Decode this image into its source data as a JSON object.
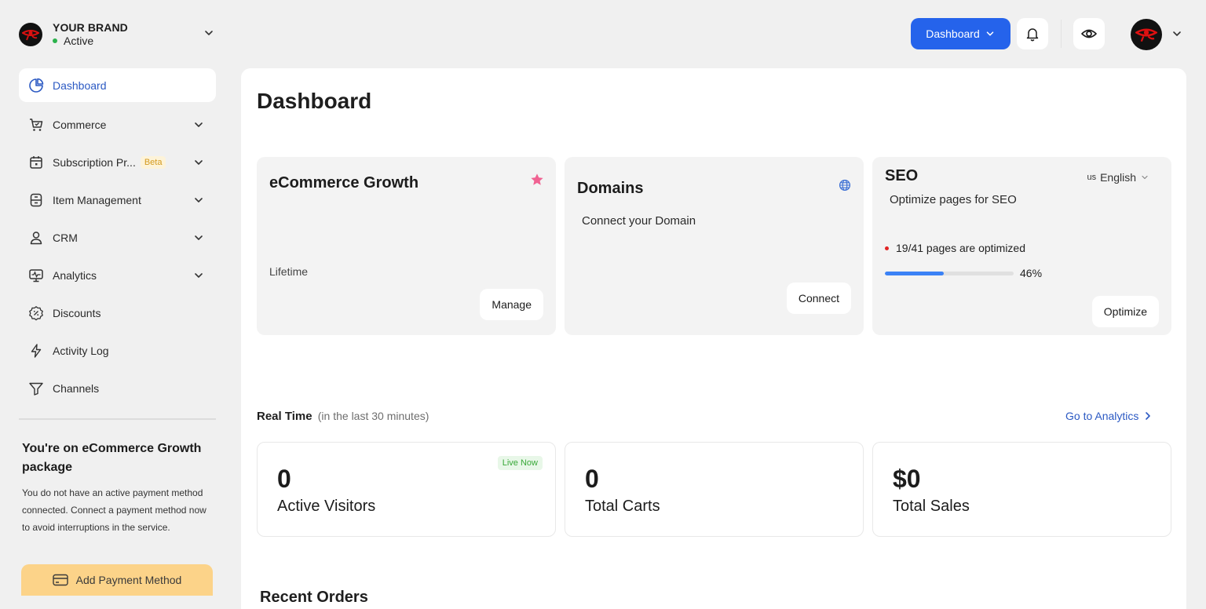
{
  "brand": {
    "name": "YOUR BRAND",
    "status": "Active"
  },
  "nav": [
    {
      "label": "Dashboard",
      "icon": "pie-chart-icon",
      "active": true
    },
    {
      "label": "Commerce",
      "icon": "cart-icon"
    },
    {
      "label": "Subscription Pr...",
      "icon": "calendar-icon",
      "badge": "Beta"
    },
    {
      "label": "Item Management",
      "icon": "box-icon"
    },
    {
      "label": "CRM",
      "icon": "user-icon"
    },
    {
      "label": "Analytics",
      "icon": "monitor-pulse-icon"
    },
    {
      "label": "Discounts",
      "icon": "discount-icon"
    },
    {
      "label": "Activity Log",
      "icon": "bolt-icon"
    },
    {
      "label": "Channels",
      "icon": "filter-icon"
    }
  ],
  "package": {
    "title": "You're on eCommerce Growth package",
    "description": "You do not have an active payment method connected. Connect a payment method now to avoid interruptions in the service.",
    "button": "Add Payment Method"
  },
  "header": {
    "dashboard_button": "Dashboard"
  },
  "page": {
    "title": "Dashboard"
  },
  "cards": {
    "growth": {
      "title": "eCommerce Growth",
      "subtitle": "Lifetime",
      "button": "Manage"
    },
    "domains": {
      "title": "Domains",
      "text": "Connect your Domain",
      "button": "Connect"
    },
    "seo": {
      "title": "SEO",
      "language_flag": "us",
      "language": "English",
      "subtitle": "Optimize pages for SEO",
      "stat": "19/41 pages are optimized",
      "percent_label": "46%",
      "percent": 46,
      "button": "Optimize"
    }
  },
  "realtime": {
    "title": "Real Time",
    "subtitle": "(in the last 30 minutes)",
    "link": "Go to Analytics",
    "stats": [
      {
        "value": "0",
        "label": "Active Visitors",
        "badge": "Live Now"
      },
      {
        "value": "0",
        "label": "Total Carts"
      },
      {
        "value": "$0",
        "label": "Total Sales"
      }
    ]
  },
  "recent_orders": {
    "title": "Recent Orders"
  },
  "colors": {
    "primary": "#2563eb",
    "accent_text": "#2b59c3",
    "payment_button": "#fcd389"
  }
}
